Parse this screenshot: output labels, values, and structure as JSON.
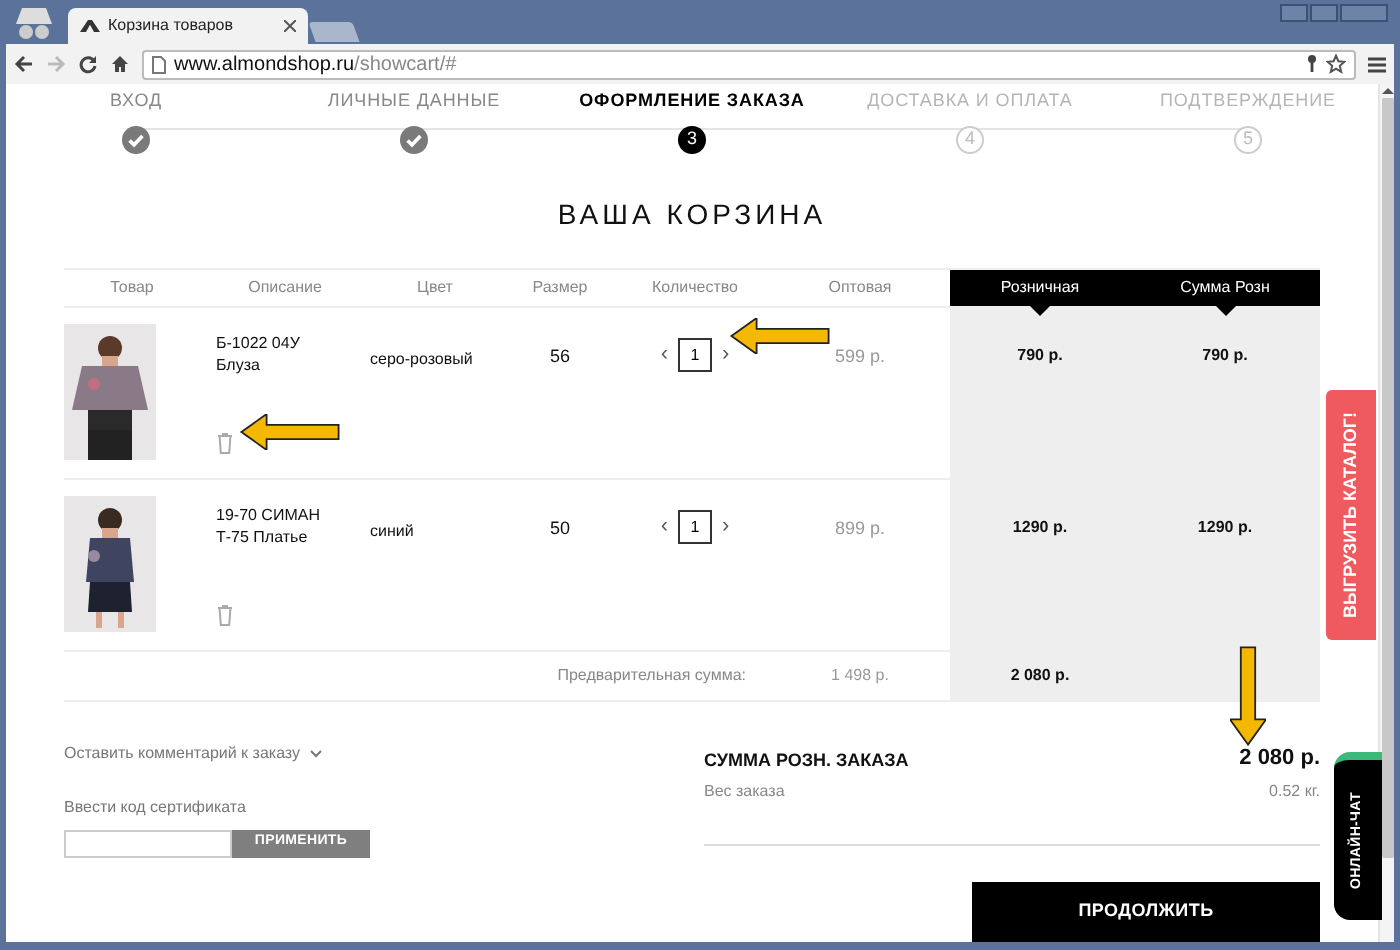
{
  "browser": {
    "tab_title": "Корзина товаров",
    "url_domain": "www.almondshop.ru",
    "url_path": "/showcart/#"
  },
  "steps": [
    {
      "label": "ВХОД",
      "completed": true,
      "selected": false
    },
    {
      "label": "ЛИЧНЫЕ ДАННЫЕ",
      "completed": true,
      "selected": false
    },
    {
      "label": "ОФОРМЛЕНИЕ ЗАКАЗА",
      "completed": false,
      "selected": true,
      "number": "3"
    },
    {
      "label": "ДОСТАВКА И ОПЛАТА",
      "completed": false,
      "selected": false,
      "number": "4"
    },
    {
      "label": "ПОДТВЕРЖДЕНИЕ",
      "completed": false,
      "selected": false,
      "number": "5"
    }
  ],
  "heading": "ВАША КОРЗИНА",
  "table": {
    "columns": [
      {
        "label": "Товар",
        "highlight": false
      },
      {
        "label": "Описание",
        "highlight": false
      },
      {
        "label": "Цвет",
        "highlight": false
      },
      {
        "label": "Размер",
        "highlight": false
      },
      {
        "label": "Количество",
        "highlight": false
      },
      {
        "label": "Оптовая",
        "highlight": false
      },
      {
        "label": "Розничная",
        "highlight": true
      },
      {
        "label": "Сумма Розн",
        "highlight": true
      }
    ],
    "rows": [
      {
        "description": "Б-1022 04У Блуза",
        "color_name": "серо-розовый",
        "size": "56",
        "decrease": "‹",
        "quantity": "1",
        "increase": "›",
        "wholesale": "599 р.",
        "retail": "790 р.",
        "retail_sum": "790 р."
      },
      {
        "description": "19-70 СИМАН Т-75 Платье",
        "color_name": "синий",
        "size": "50",
        "decrease": "‹",
        "quantity": "1",
        "increase": "›",
        "wholesale": "899 р.",
        "retail": "1290 р.",
        "retail_sum": "1290 р."
      }
    ],
    "subtotal": {
      "label": "Предварительная сумма:",
      "wholesale": "1 498 р.",
      "retail": "2 080 р."
    }
  },
  "comment_toggle": "Оставить комментарий к заказу",
  "certificate": {
    "label": "Ввести код сертификата",
    "button": "ПРИМЕНИТЬ"
  },
  "summary": {
    "total_label": "СУММА РОЗН. ЗАКАЗА",
    "total": "2 080 р.",
    "weight_label": "Вес заказа",
    "weight": "0.52 кг."
  },
  "continue_button": "ПРОДОЛЖИТЬ",
  "side_tabs": {
    "catalog": "ВЫГРУЗИТЬ КАТАЛОГ!",
    "chat": "ОНЛАЙН-ЧАТ"
  }
}
